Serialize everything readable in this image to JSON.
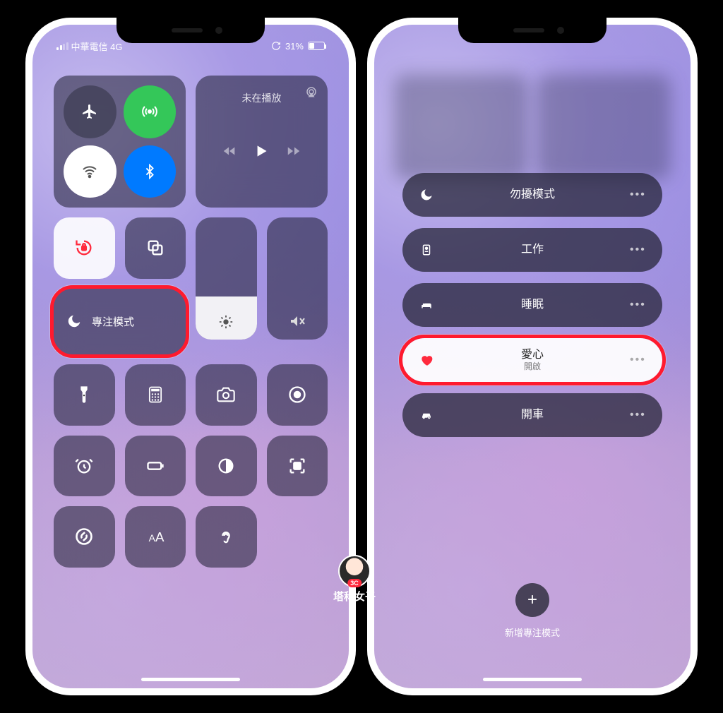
{
  "status": {
    "carrier": "中華電信 4G",
    "battery_pct": "31%"
  },
  "media": {
    "not_playing": "未在播放"
  },
  "focus_button_label": "專注模式",
  "focus_modes": {
    "dnd": "勿擾模式",
    "work": "工作",
    "sleep": "睡眠",
    "love": "愛心",
    "love_status": "開啟",
    "drive": "開車"
  },
  "add_focus": {
    "label": "新增專注模式"
  },
  "watermark": "塔科女子",
  "icons": {
    "more": "•••",
    "plus": "+"
  }
}
